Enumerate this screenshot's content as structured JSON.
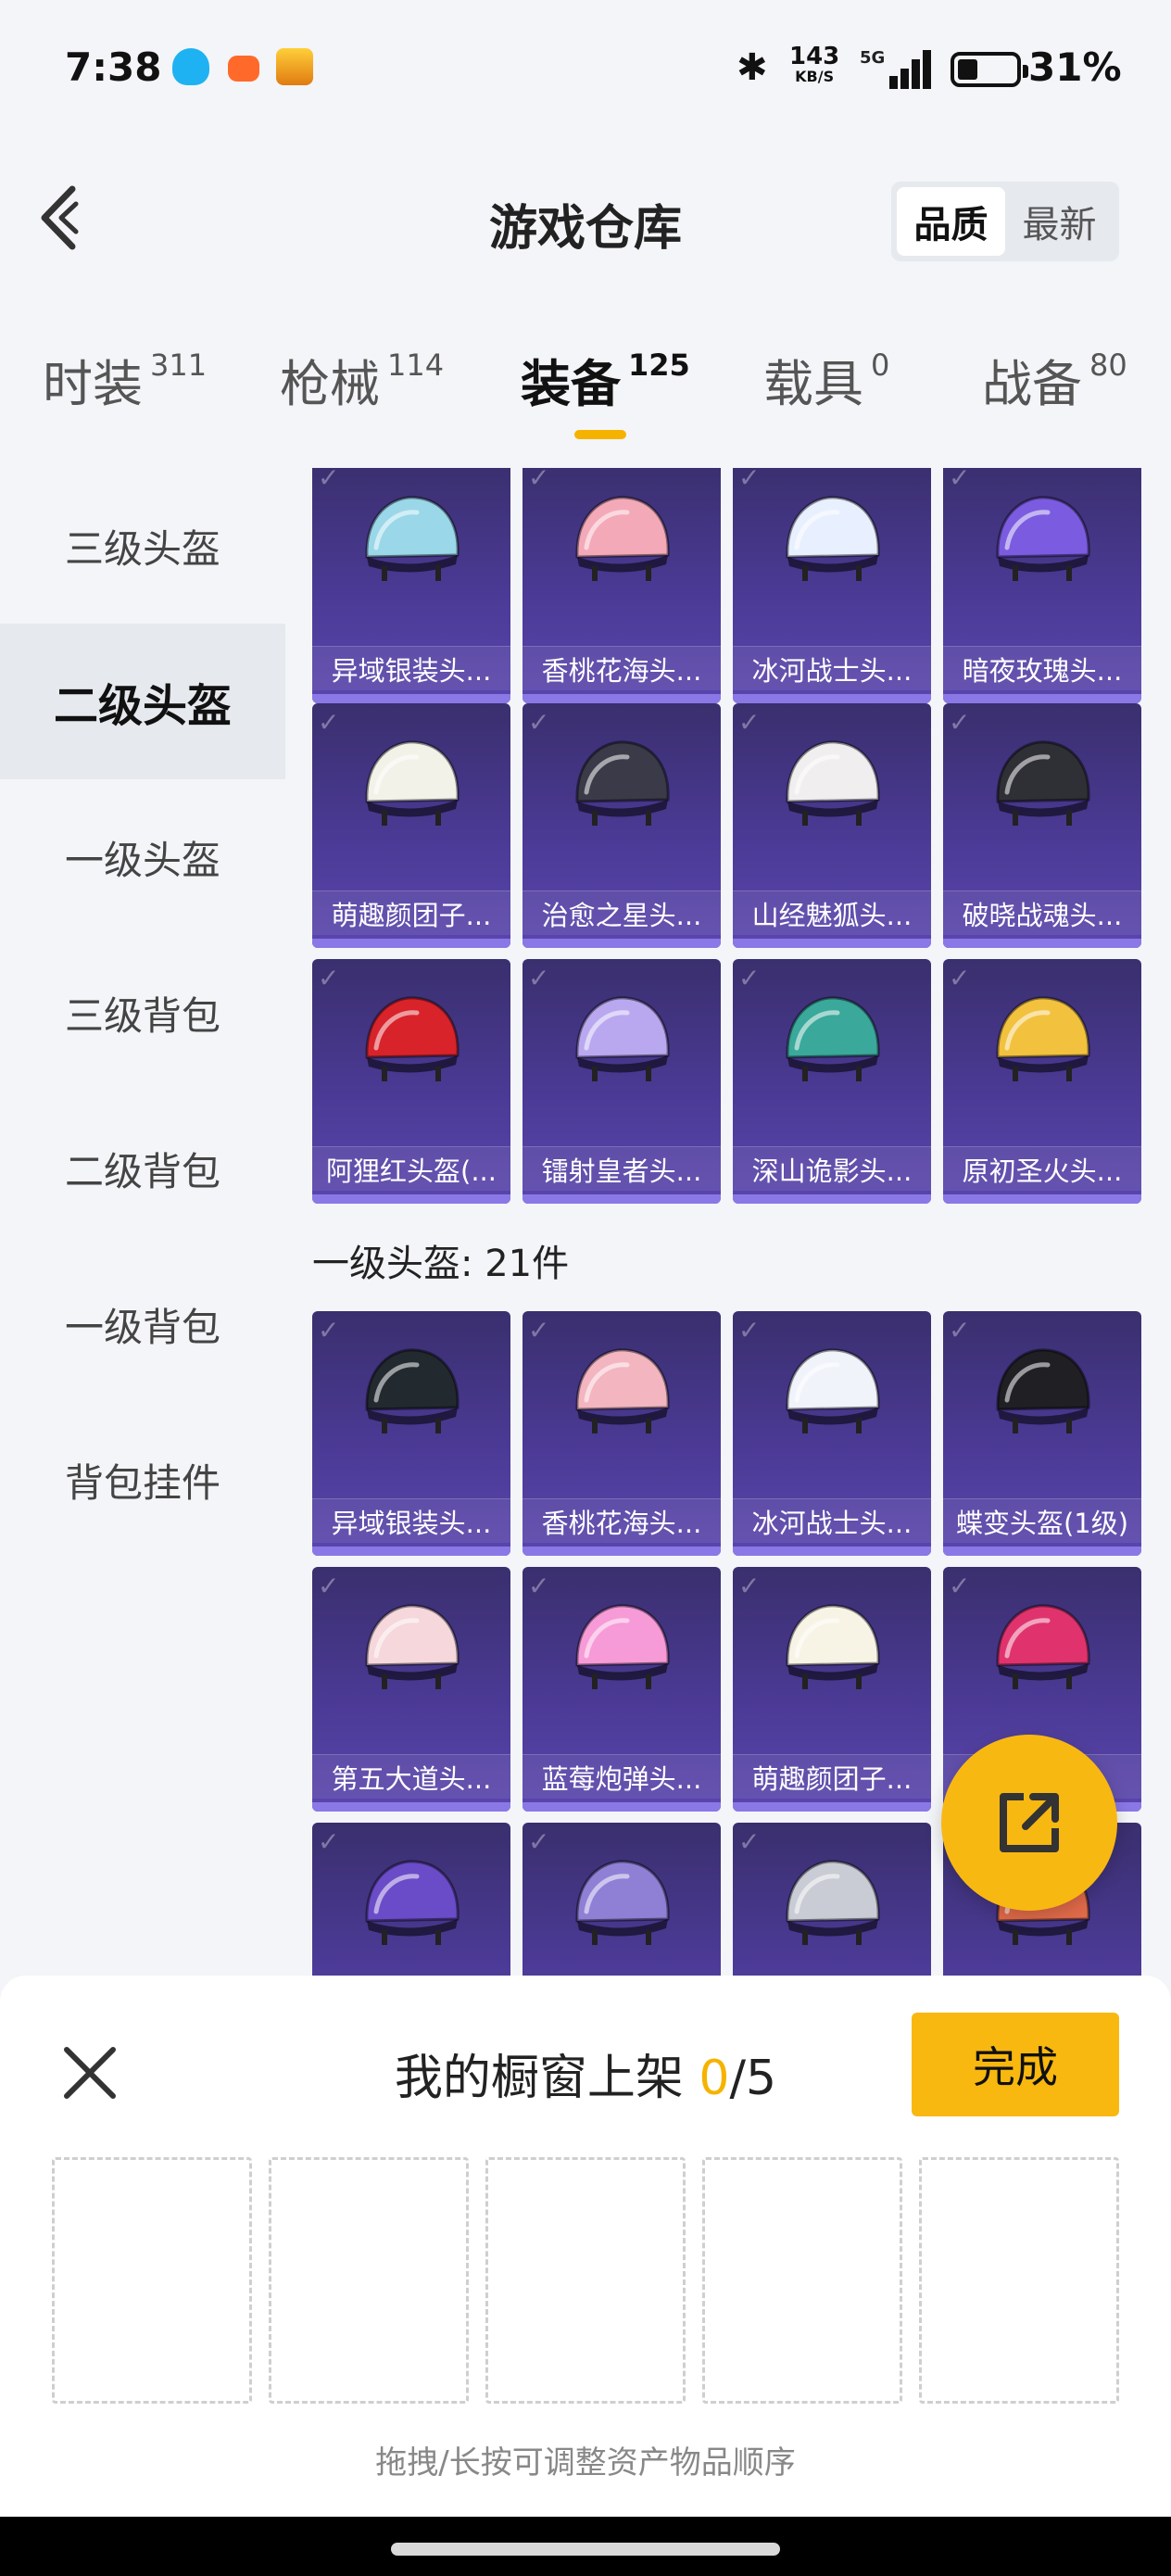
{
  "status_bar": {
    "time": "7:38",
    "net_speed": "143",
    "net_unit": "KB/S",
    "network": "5G",
    "battery_pct": "31%",
    "battery_level": 0.31
  },
  "header": {
    "title": "游戏仓库",
    "sort_options": [
      "品质",
      "最新"
    ],
    "sort_selected": "品质"
  },
  "category_tabs": [
    {
      "label": "时装",
      "count": "311"
    },
    {
      "label": "枪械",
      "count": "114"
    },
    {
      "label": "装备",
      "count": "125",
      "active": true
    },
    {
      "label": "载具",
      "count": "0"
    },
    {
      "label": "战备",
      "count": "80"
    }
  ],
  "sidebar": {
    "items": [
      "三级头盔",
      "二级头盔",
      "一级头盔",
      "三级背包",
      "二级背包",
      "一级背包",
      "背包挂件"
    ],
    "active": "二级头盔"
  },
  "sections": [
    {
      "title": "",
      "items": [
        {
          "name": "异域银装头...",
          "icon": "helmet-icon",
          "color": "#9ad7e8"
        },
        {
          "name": "香桃花海头...",
          "icon": "helmet-icon",
          "color": "#f4a9b8"
        },
        {
          "name": "冰河战士头...",
          "icon": "helmet-icon",
          "color": "#e8f0ff"
        },
        {
          "name": "暗夜玫瑰头...",
          "icon": "helmet-icon",
          "color": "#7b5be0"
        },
        {
          "name": "萌趣颜团子...",
          "icon": "helmet-icon",
          "color": "#f2f2e8"
        },
        {
          "name": "治愈之星头...",
          "icon": "helmet-icon",
          "color": "#3a3a48"
        },
        {
          "name": "山经魅狐头...",
          "icon": "helmet-icon",
          "color": "#f1eef0"
        },
        {
          "name": "破晓战魂头...",
          "icon": "helmet-icon",
          "color": "#2f2f36"
        },
        {
          "name": "阿狸红头盔(...",
          "icon": "helmet-icon",
          "color": "#d8232a"
        },
        {
          "name": "镭射皇者头...",
          "icon": "helmet-icon",
          "color": "#b9a8f0"
        },
        {
          "name": "深山诡影头...",
          "icon": "helmet-icon",
          "color": "#3aa89a"
        },
        {
          "name": "原初圣火头...",
          "icon": "helmet-icon",
          "color": "#f2c23e"
        }
      ]
    },
    {
      "title": "一级头盔: 21件",
      "items": [
        {
          "name": "异域银装头...",
          "icon": "helmet-icon",
          "color": "#22292f"
        },
        {
          "name": "香桃花海头...",
          "icon": "helmet-icon",
          "color": "#f3b5c0"
        },
        {
          "name": "冰河战士头...",
          "icon": "helmet-icon",
          "color": "#f0f3fa"
        },
        {
          "name": "蝶变头盔(1级)",
          "icon": "helmet-icon",
          "color": "#1f1f24"
        },
        {
          "name": "第五大道头...",
          "icon": "helmet-icon",
          "color": "#f5d7dc"
        },
        {
          "name": "蓝莓炮弹头...",
          "icon": "helmet-icon",
          "color": "#f79ad8"
        },
        {
          "name": "萌趣颜团子...",
          "icon": "helmet-icon",
          "color": "#f7f4e6"
        },
        {
          "name": "",
          "icon": "helmet-icon",
          "color": "#e0336e"
        },
        {
          "name": "",
          "icon": "helmet-icon",
          "color": "#6a4bc8"
        },
        {
          "name": "",
          "icon": "helmet-icon",
          "color": "#8f80d6"
        },
        {
          "name": "",
          "icon": "helmet-icon",
          "color": "#c9ccd4"
        },
        {
          "name": "",
          "icon": "helmet-icon",
          "color": "#e06a4a"
        }
      ]
    }
  ],
  "fab": {
    "icon": "share-external-icon"
  },
  "shelf": {
    "title_prefix": "我的橱窗上架 ",
    "count": "0",
    "total": "/5",
    "done_label": "完成",
    "hint": "拖拽/长按可调整资产物品顺序",
    "slots": 5
  },
  "colors": {
    "accent": "#f5b300",
    "card_bg": "#4b3a95",
    "fab": "#f8b812"
  }
}
